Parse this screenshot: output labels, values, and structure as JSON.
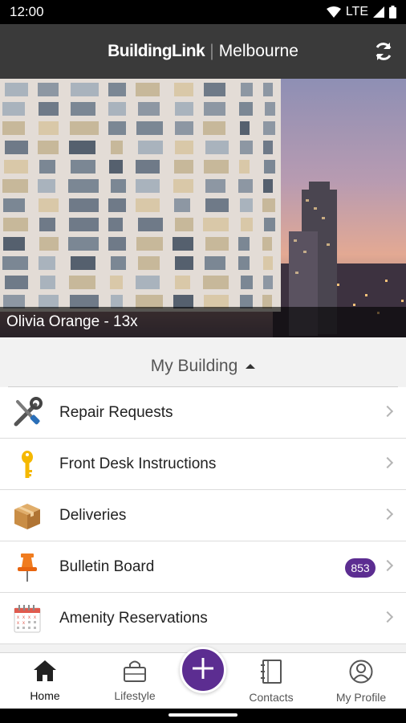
{
  "status_bar": {
    "time": "12:00",
    "network": "LTE"
  },
  "app_bar": {
    "brand_name": "BuildingLink",
    "separator": "|",
    "city": "Melbourne",
    "refresh_icon": "refresh-icon"
  },
  "hero": {
    "caption": "Olivia Orange - 13x"
  },
  "section": {
    "title": "My Building",
    "toggle_icon": "caret-up-icon"
  },
  "menu": {
    "items": [
      {
        "label": "Repair Requests",
        "icon": "tools-icon"
      },
      {
        "label": "Front Desk Instructions",
        "icon": "key-icon"
      },
      {
        "label": "Deliveries",
        "icon": "package-icon"
      },
      {
        "label": "Bulletin Board",
        "icon": "pushpin-icon",
        "badge": "853"
      },
      {
        "label": "Amenity Reservations",
        "icon": "calendar-icon"
      }
    ]
  },
  "bottom_nav": {
    "items": [
      {
        "label": "Home",
        "icon": "home-icon",
        "active": true
      },
      {
        "label": "Lifestyle",
        "icon": "shopping-bag-icon"
      },
      {
        "label": "Contacts",
        "icon": "address-book-icon"
      },
      {
        "label": "My Profile",
        "icon": "profile-icon"
      }
    ],
    "fab_icon": "plus-icon"
  },
  "colors": {
    "accent": "#5c2d91",
    "app_bar": "#3a3a3a",
    "key_yellow": "#f5b800",
    "pin_orange": "#f07c1f"
  }
}
